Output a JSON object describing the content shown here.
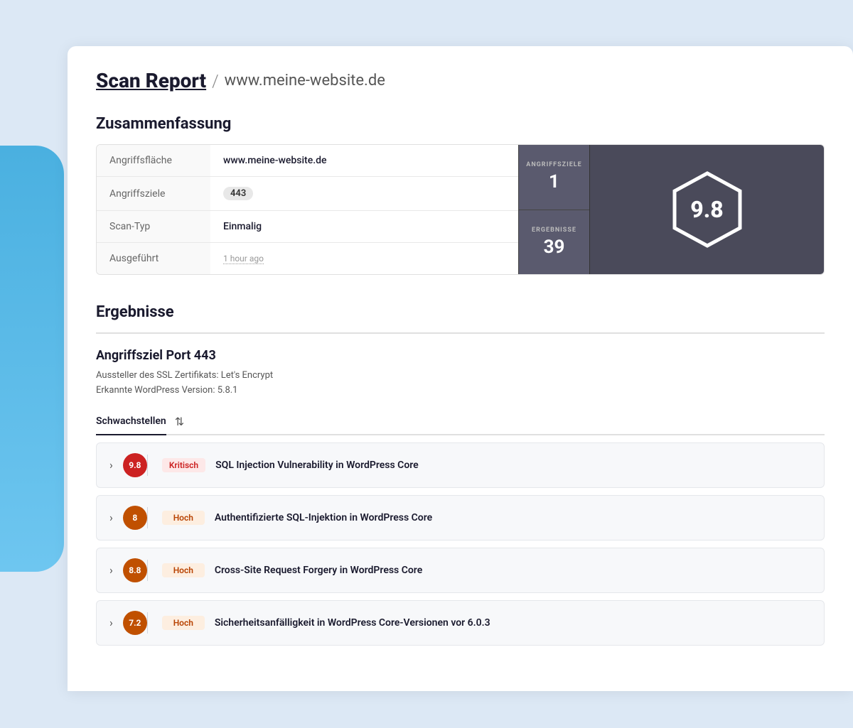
{
  "header": {
    "scan_report_label": "Scan Report",
    "separator": "/",
    "domain": "www.meine-website.de"
  },
  "summary_section": {
    "title": "Zusammenfassung",
    "rows": [
      {
        "label": "Angriffsfläche",
        "value": "www.meine-website.de",
        "type": "text"
      },
      {
        "label": "Angriffsziele",
        "value": "443",
        "type": "badge"
      },
      {
        "label": "Scan-Typ",
        "value": "Einmalig",
        "type": "text"
      },
      {
        "label": "Ausgeführt",
        "value": "1 hour ago",
        "type": "time"
      }
    ],
    "stats": {
      "angriffsziele_label": "ANGRIFFSZIELE",
      "angriffsziele_value": "1",
      "ergebnisse_label": "ERGEBNISSE",
      "ergebnisse_value": "39"
    },
    "score": "9.8"
  },
  "results_section": {
    "title": "Ergebnisse",
    "attack_target": {
      "title": "Angriffsziel Port 443",
      "meta_line1": "Aussteller des SSL Zertifikats: Let's Encrypt",
      "meta_line2": "Erkannte WordPress Version: 5.8.1"
    },
    "tab": {
      "label": "Schwachstellen",
      "sort_icon": "⇅"
    },
    "vulnerabilities": [
      {
        "score": "9.8",
        "severity": "Kritisch",
        "severity_type": "kritisch",
        "name": "SQL Injection Vulnerability in WordPress Core"
      },
      {
        "score": "8",
        "severity": "Hoch",
        "severity_type": "hoch",
        "name": "Authentifizierte SQL-Injektion in WordPress Core"
      },
      {
        "score": "8.8",
        "severity": "Hoch",
        "severity_type": "hoch",
        "name": "Cross-Site Request Forgery in WordPress Core"
      },
      {
        "score": "7.2",
        "severity": "Hoch",
        "severity_type": "hoch",
        "name": "Sicherheitsanfälligkeit in WordPress Core-Versionen vor 6.0.3"
      }
    ]
  },
  "colors": {
    "kritisch_bg": "#cc2222",
    "hoch_bg": "#c05000",
    "accent_blue": "#3b9fd4"
  }
}
